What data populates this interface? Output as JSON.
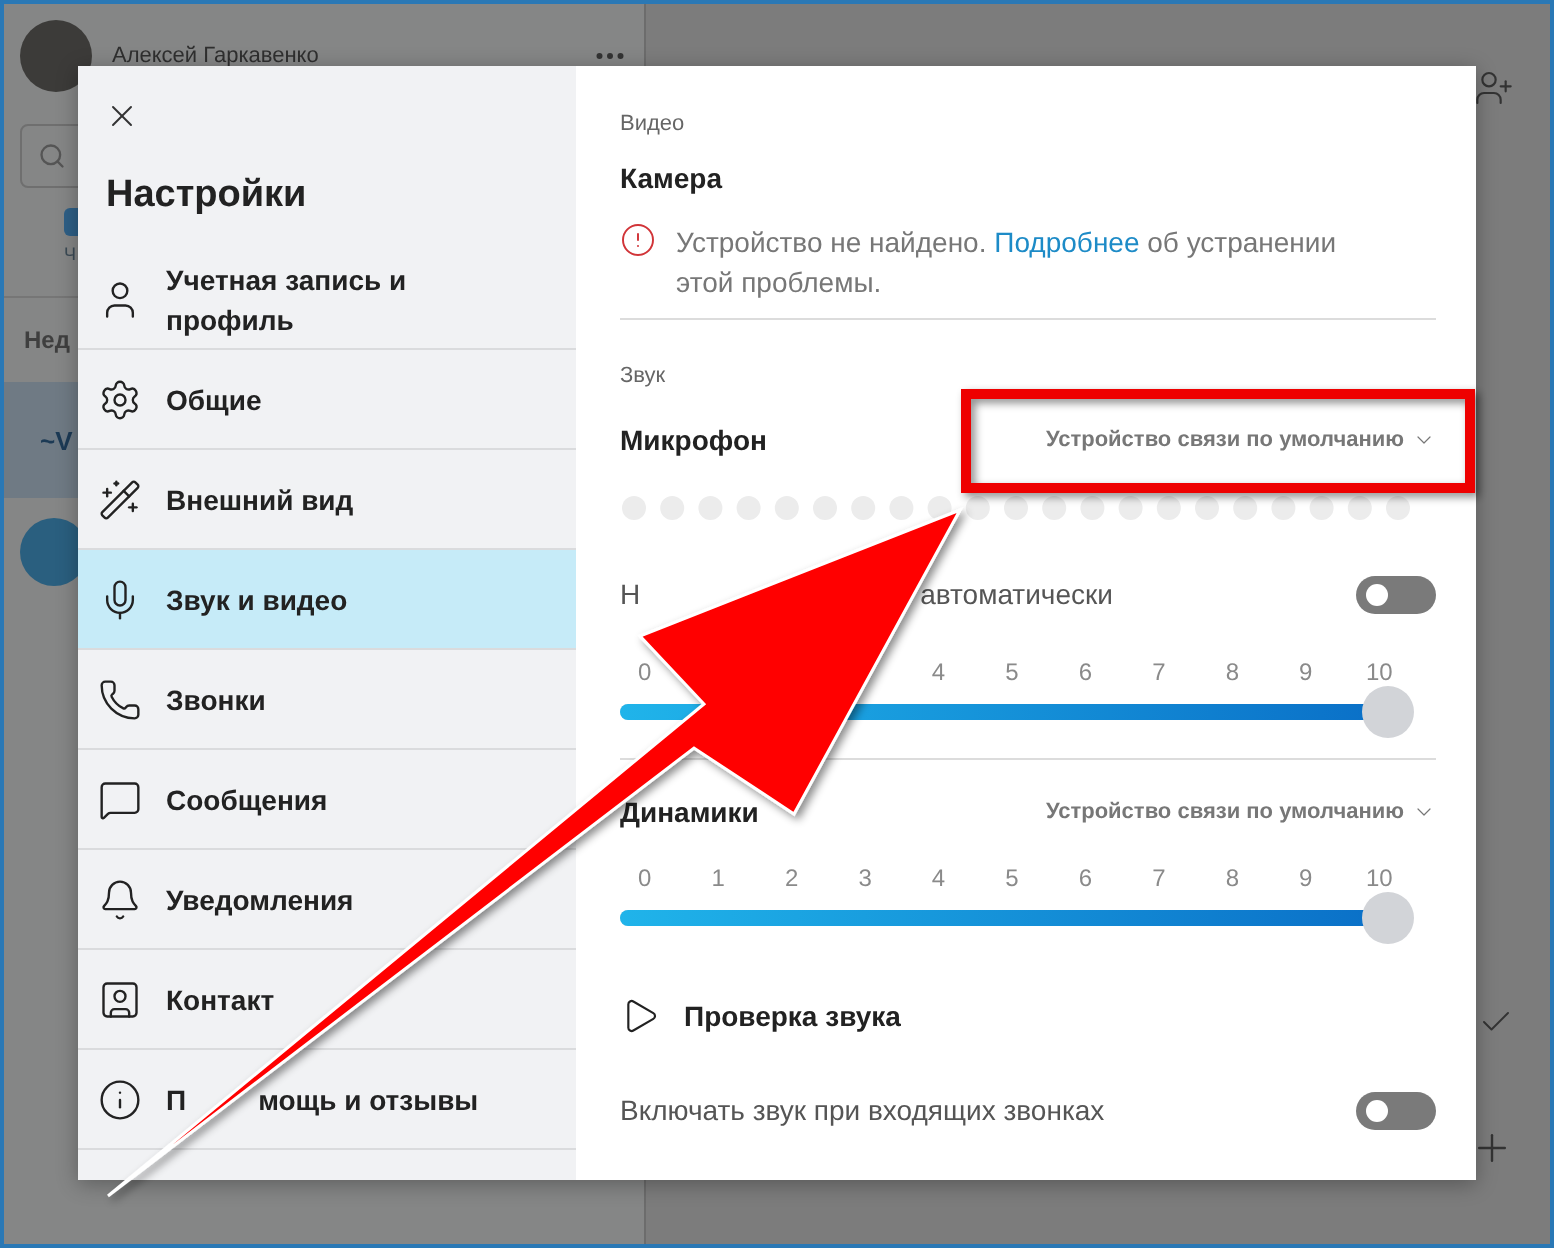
{
  "app": {
    "user_name": "Алексей Гаркавенко",
    "tab_fragment": "Ч",
    "section_fragment": "Нед",
    "chat_initials": "~V"
  },
  "settings": {
    "title": "Настройки",
    "nav": [
      {
        "kind": "account",
        "label": "Учетная запись и профиль",
        "selected": false
      },
      {
        "kind": "general",
        "label": "Общие",
        "selected": false
      },
      {
        "kind": "appearance",
        "label": "Внешний вид",
        "selected": false
      },
      {
        "kind": "audio",
        "label": "Звук и видео",
        "selected": true
      },
      {
        "kind": "calls",
        "label": "Звонки",
        "selected": false
      },
      {
        "kind": "messages",
        "label": "Сообщения",
        "selected": false
      },
      {
        "kind": "notifications",
        "label": "Уведомления",
        "selected": false
      },
      {
        "kind": "contacts",
        "label": "Контакт",
        "selected": false
      },
      {
        "kind": "help",
        "label_parts": [
          "П",
          "мощь и отзывы"
        ],
        "selected": false
      }
    ],
    "video": {
      "heading": "Видео",
      "camera_label": "Камера",
      "error_before": "Устройство не найдено.",
      "error_link": "Подробнее",
      "error_after": "об устранении этой проблемы."
    },
    "audio": {
      "heading": "Звук",
      "microphone_label": "Микрофон",
      "microphone_device": "Устройство связи по умолчанию",
      "auto_label_parts": [
        "Н",
        "автоматически"
      ],
      "auto_on": false,
      "mic_slider": {
        "ticks": [
          "0",
          "4",
          "5",
          "6",
          "7",
          "8",
          "9",
          "10"
        ],
        "level": 1
      },
      "speakers_label": "Динамики",
      "speakers_device": "Устройство связи по умолчанию",
      "speaker_slider": {
        "ticks": [
          "0",
          "1",
          "2",
          "3",
          "4",
          "5",
          "6",
          "7",
          "8",
          "9",
          "10"
        ],
        "level": 1
      },
      "test_label": "Проверка звука",
      "incoming_label": "Включать звук при входящих звонках",
      "incoming_on": false
    }
  }
}
